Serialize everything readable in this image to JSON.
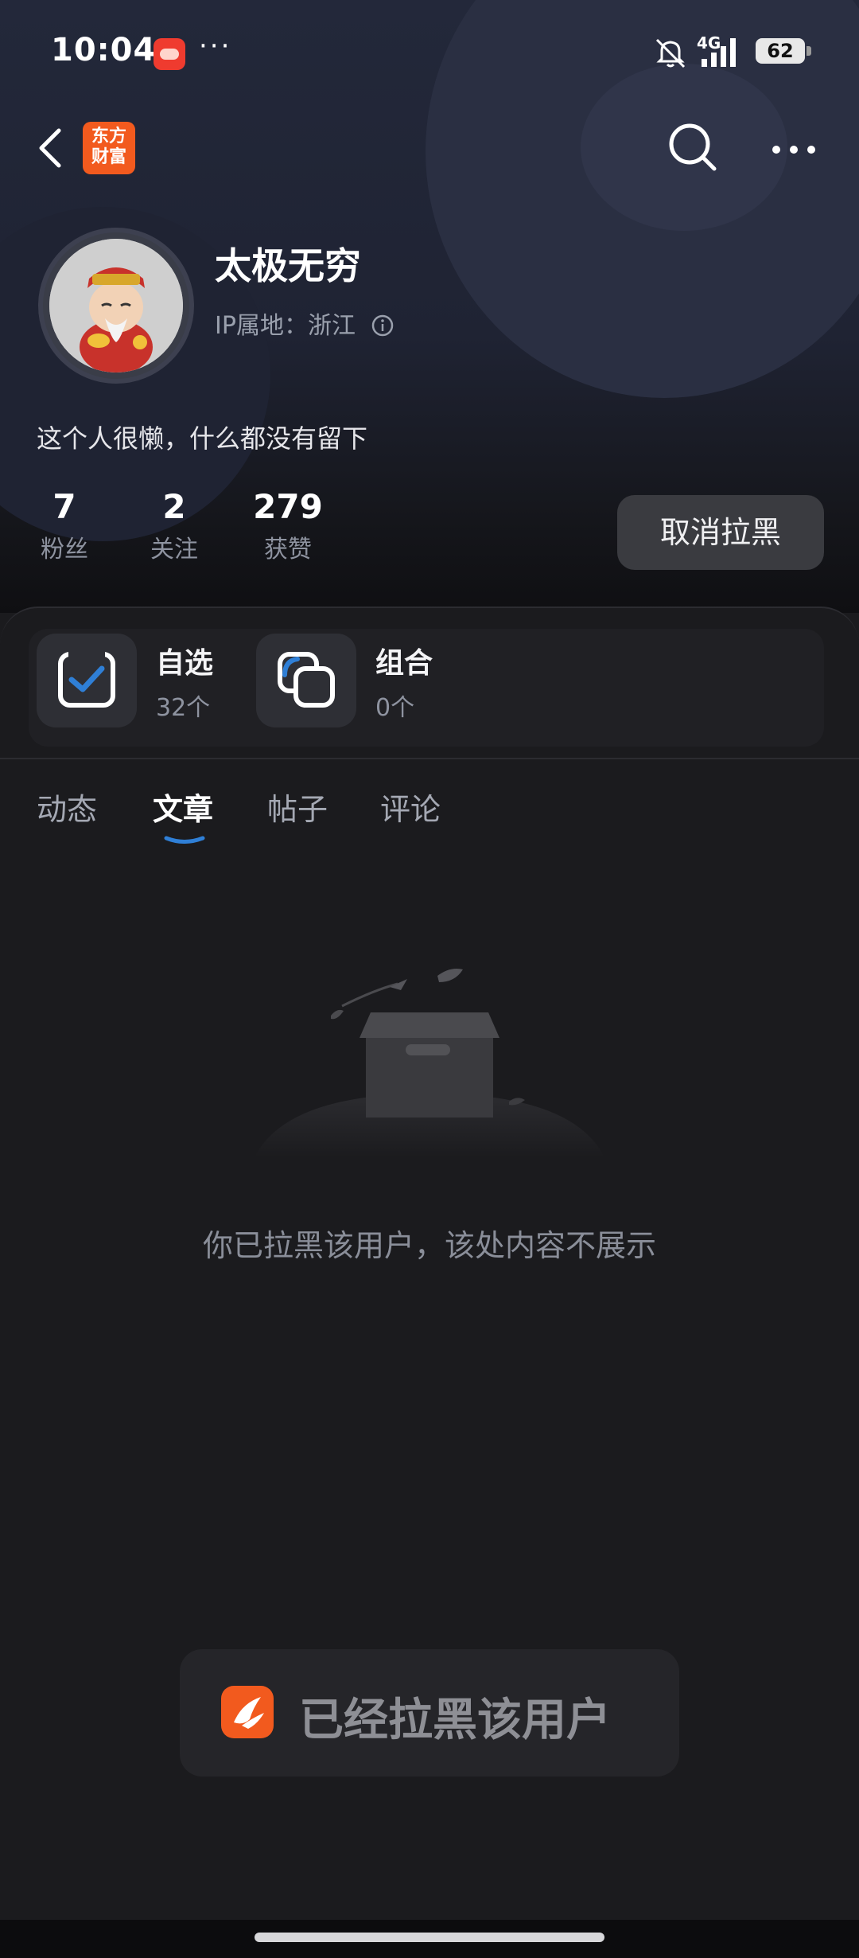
{
  "status_bar": {
    "time": "10:04",
    "dots": "···",
    "network": "4G",
    "battery": "62"
  },
  "nav": {
    "brand_logo": "东方\n财富",
    "brand_logo_line1": "东方",
    "brand_logo_line2": "财富"
  },
  "profile": {
    "name": "太极无穷",
    "ip_location": "IP属地：浙江",
    "bio": "这个人很懒，什么都没有留下",
    "stats": [
      {
        "value": "7",
        "label": "粉丝"
      },
      {
        "value": "2",
        "label": "关注"
      },
      {
        "value": "279",
        "label": "获赞"
      }
    ],
    "unblock_button": "取消拉黑"
  },
  "features": {
    "watchlist": {
      "title": "自选",
      "count": "32个"
    },
    "portfolio": {
      "title": "组合",
      "count": "0个"
    }
  },
  "tabs": [
    {
      "label": "动态",
      "active": false
    },
    {
      "label": "文章",
      "active": true
    },
    {
      "label": "帖子",
      "active": false
    },
    {
      "label": "评论",
      "active": false
    }
  ],
  "empty_state": {
    "message": "你已拉黑该用户，该处内容不展示"
  },
  "toast": {
    "message": "已经拉黑该用户"
  },
  "colors": {
    "background": "#1b1b1e",
    "header": "#23283a",
    "brand": "#f25a1e",
    "tab_indicator": "#2f7fd6",
    "muted_text": "#8e93a0"
  }
}
